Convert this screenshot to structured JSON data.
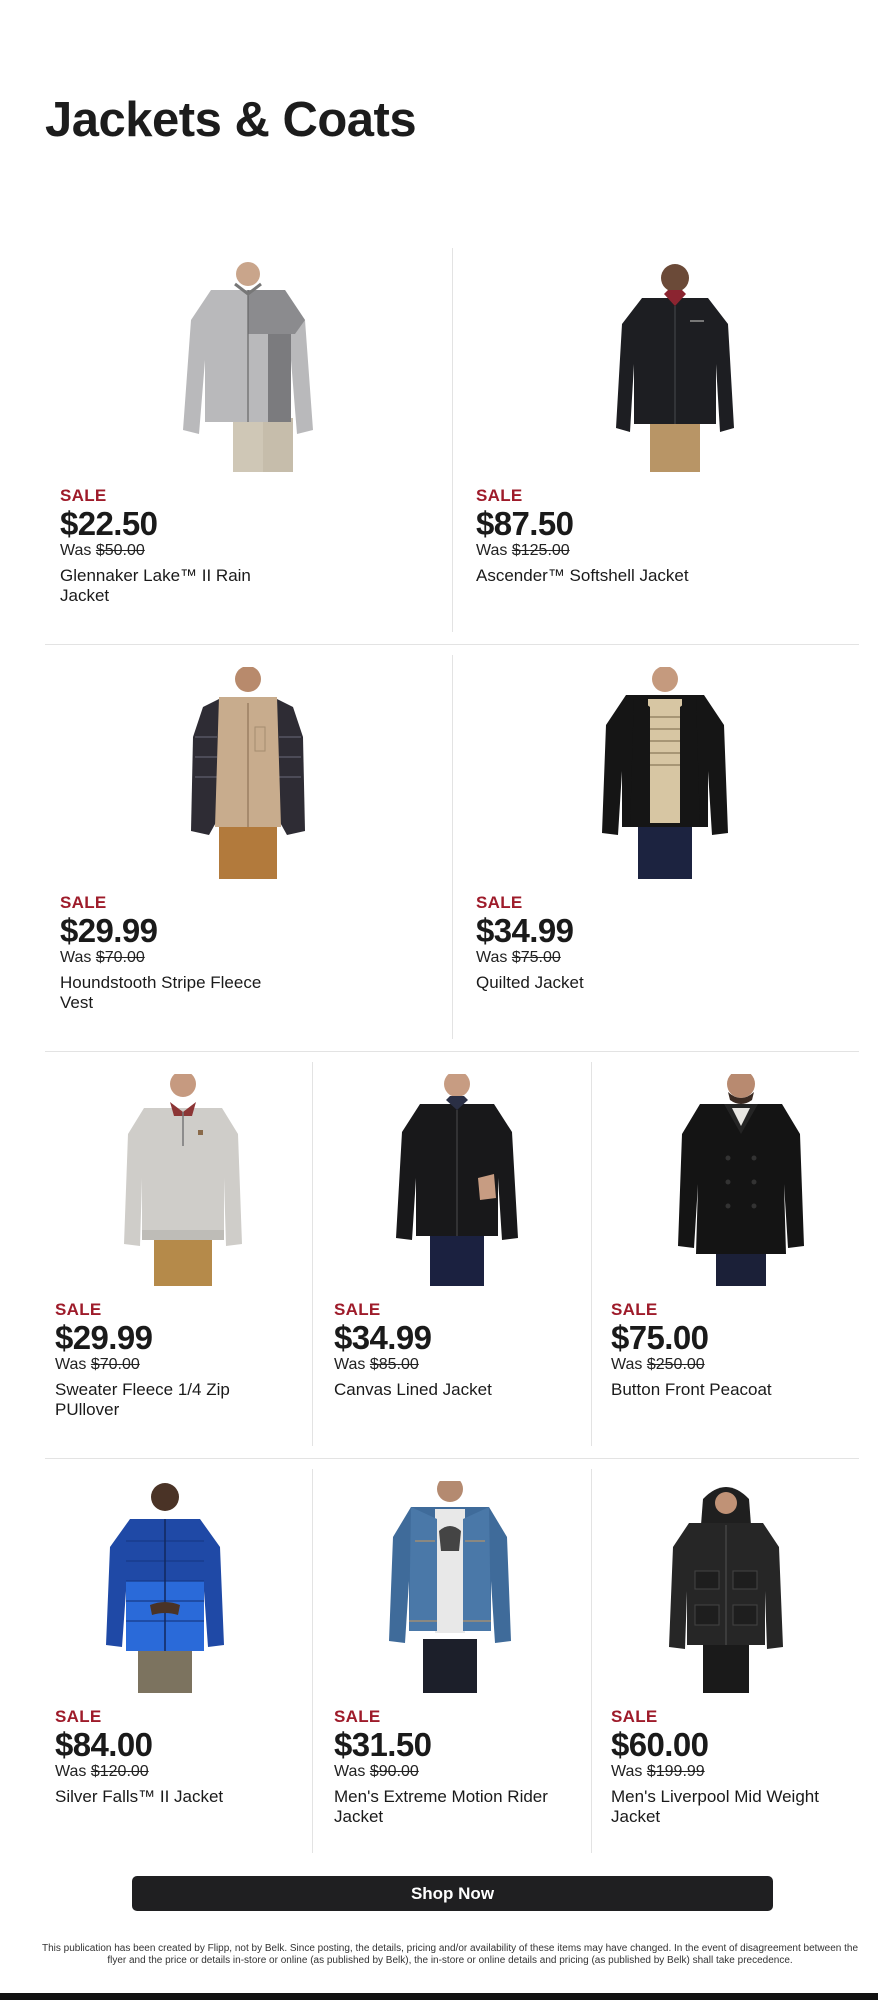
{
  "page": {
    "title": "Jackets & Coats"
  },
  "colors": {
    "sale": "#9e1b2a",
    "button": "#1f1f21"
  },
  "products": [
    {
      "sale": "SALE",
      "price": "$22.50",
      "was_label": "Was",
      "was_price": "$50.00",
      "name": "Glennaker Lake™ II Rain Jacket",
      "image": "gray-softshell-jacket"
    },
    {
      "sale": "SALE",
      "price": "$87.50",
      "was_label": "Was",
      "was_price": "$125.00",
      "name": "Ascender™ Softshell Jacket",
      "image": "black-softshell-jacket"
    },
    {
      "sale": "SALE",
      "price": "$29.99",
      "was_label": "Was",
      "was_price": "$70.00",
      "name": "Houndstooth Stripe Fleece Vest",
      "image": "tan-fleece-vest"
    },
    {
      "sale": "SALE",
      "price": "$34.99",
      "was_label": "Was",
      "was_price": "$75.00",
      "name": "Quilted Jacket",
      "image": "black-bomber-jacket"
    },
    {
      "sale": "SALE",
      "price": "$29.99",
      "was_label": "Was",
      "was_price": "$70.00",
      "name": "Sweater Fleece 1/4 Zip PUllover",
      "image": "gray-quarter-zip"
    },
    {
      "sale": "SALE",
      "price": "$34.99",
      "was_label": "Was",
      "was_price": "$85.00",
      "name": "Canvas Lined Jacket",
      "image": "black-canvas-jacket"
    },
    {
      "sale": "SALE",
      "price": "$75.00",
      "was_label": "Was",
      "was_price": "$250.00",
      "name": "Button Front Peacoat",
      "image": "black-peacoat"
    },
    {
      "sale": "SALE",
      "price": "$84.00",
      "was_label": "Was",
      "was_price": "$120.00",
      "name": "Silver Falls™ II Jacket",
      "image": "blue-puffer-jacket"
    },
    {
      "sale": "SALE",
      "price": "$31.50",
      "was_label": "Was",
      "was_price": "$90.00",
      "name": "Men's Extreme Motion Rider Jacket",
      "image": "denim-jacket"
    },
    {
      "sale": "SALE",
      "price": "$60.00",
      "was_label": "Was",
      "was_price": "$199.99",
      "name": "Men's Liverpool Mid Weight Jacket",
      "image": "black-hooded-parka"
    }
  ],
  "cta": {
    "label": "Shop Now"
  },
  "disclaimer": "This publication has been created by Flipp, not by Belk. Since posting, the details, pricing and/or availability of these items may have changed. In the event of disagreement between the flyer and the price or details in-store or online (as published by Belk), the in-store or online details and pricing (as published by Belk) shall take precedence."
}
